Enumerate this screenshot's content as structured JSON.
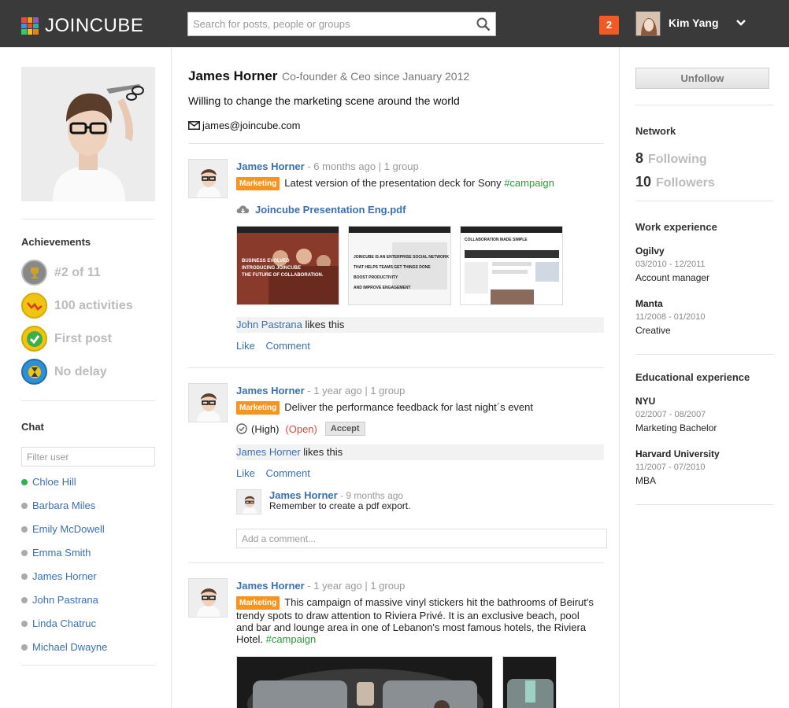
{
  "app": {
    "brand": "JOINCUBE"
  },
  "search": {
    "placeholder": "Search for posts, people or groups"
  },
  "topbar": {
    "notification_count": "2",
    "user_name": "Kim Yang"
  },
  "profile": {
    "name": "James Horner",
    "role": "Co-founder & Ceo since January 2012",
    "tagline": "Willing to change the marketing scene around the world",
    "email": "james@joincube.com"
  },
  "achievements": {
    "title": "Achievements",
    "items": [
      {
        "label": "#2 of 11",
        "icon": "trophy-icon"
      },
      {
        "label": "100 activities",
        "icon": "activity-graph-icon"
      },
      {
        "label": "First post",
        "icon": "checkmark-icon"
      },
      {
        "label": "No delay",
        "icon": "hourglass-icon"
      }
    ]
  },
  "chat": {
    "title": "Chat",
    "filter_placeholder": "Filter user",
    "users": [
      {
        "name": "Chloe Hill",
        "online": true
      },
      {
        "name": "Barbara Miles",
        "online": false
      },
      {
        "name": "Emily McDowell",
        "online": false
      },
      {
        "name": "Emma Smith",
        "online": false
      },
      {
        "name": "James Horner",
        "online": false
      },
      {
        "name": "John Pastrana",
        "online": false
      },
      {
        "name": "Linda Chatruc",
        "online": false
      },
      {
        "name": "Michael Dwayne",
        "online": false
      }
    ]
  },
  "posts": [
    {
      "author": "James Horner",
      "meta": "- 6 months ago | 1 group",
      "tag": "Marketing",
      "text": "Latest version of the presentation deck for Sony",
      "hashtag": "#campaign",
      "attachment": "Joincube Presentation Eng.pdf",
      "liker": "John Pastrana",
      "likes_suffix": "likes this",
      "like_label": "Like",
      "comment_label": "Comment"
    },
    {
      "author": "James Horner",
      "meta": "- 1 year ago | 1 group",
      "tag": "Marketing",
      "text": "Deliver the performance feedback for last night´s event",
      "priority": "(High)",
      "status": "(Open)",
      "accept_label": "Accept",
      "liker": "James Horner",
      "likes_suffix": "likes this",
      "like_label": "Like",
      "comment_label": "Comment",
      "comment": {
        "author": "James Horner",
        "meta": "- 9 months ago",
        "text": "Remember to create a pdf export."
      },
      "add_comment_placeholder": "Add a comment..."
    },
    {
      "author": "James Horner",
      "meta": "- 1 year ago | 1 group",
      "tag": "Marketing",
      "text_line1": "This campaign of massive vinyl stickers hit the bathrooms of Beirut's",
      "text_line2": "trendy spots to draw attention to Riviera Privé. It is an exclusive beach, pool",
      "text_line3": "and bar and lounge area in one of Lebanon's most famous hotels, the Riviera",
      "text_line4": "Hotel.",
      "hashtag": "#campaign"
    }
  ],
  "thumbs": {
    "slide1_lines": [
      "BUSINESS EVOLVED",
      "INTRODUCING JOINCUBE",
      "THE FUTURE OF COLLABORATION."
    ],
    "slide2_lines": [
      "JOINCUBE IS AN ENTERPRISE SOCIAL NETWORK",
      "THAT HELPS TEAMS GET THINGS DONE",
      "BOOST PRODUCTIVITY",
      "AND IMPROVE ENGAGEMENT"
    ],
    "slide3_title": "COLLABORATION MADE SIMPLE"
  },
  "sidebar_right": {
    "unfollow_label": "Unfollow",
    "network_title": "Network",
    "following_count": "8",
    "following_label": "Following",
    "followers_count": "10",
    "followers_label": "Followers",
    "work_title": "Work experience",
    "work": [
      {
        "company": "Ogilvy",
        "dates": "03/2010 - 12/2011",
        "role": "Account manager"
      },
      {
        "company": "Manta",
        "dates": "11/2008 - 01/2010",
        "role": "Creative"
      }
    ],
    "edu_title": "Educational experience",
    "education": [
      {
        "school": "NYU",
        "dates": "02/2007 - 08/2007",
        "degree": "Marketing Bachelor"
      },
      {
        "school": "Harvard University",
        "dates": "11/2007 - 07/2010",
        "degree": "MBA"
      }
    ]
  },
  "colors": {
    "topbar": "#3a3a3a",
    "link": "#3a6fb0",
    "tag": "#f7941d",
    "notification": "#f15a24",
    "hashtag": "#2a9a3a",
    "online": "#2bb24c"
  }
}
